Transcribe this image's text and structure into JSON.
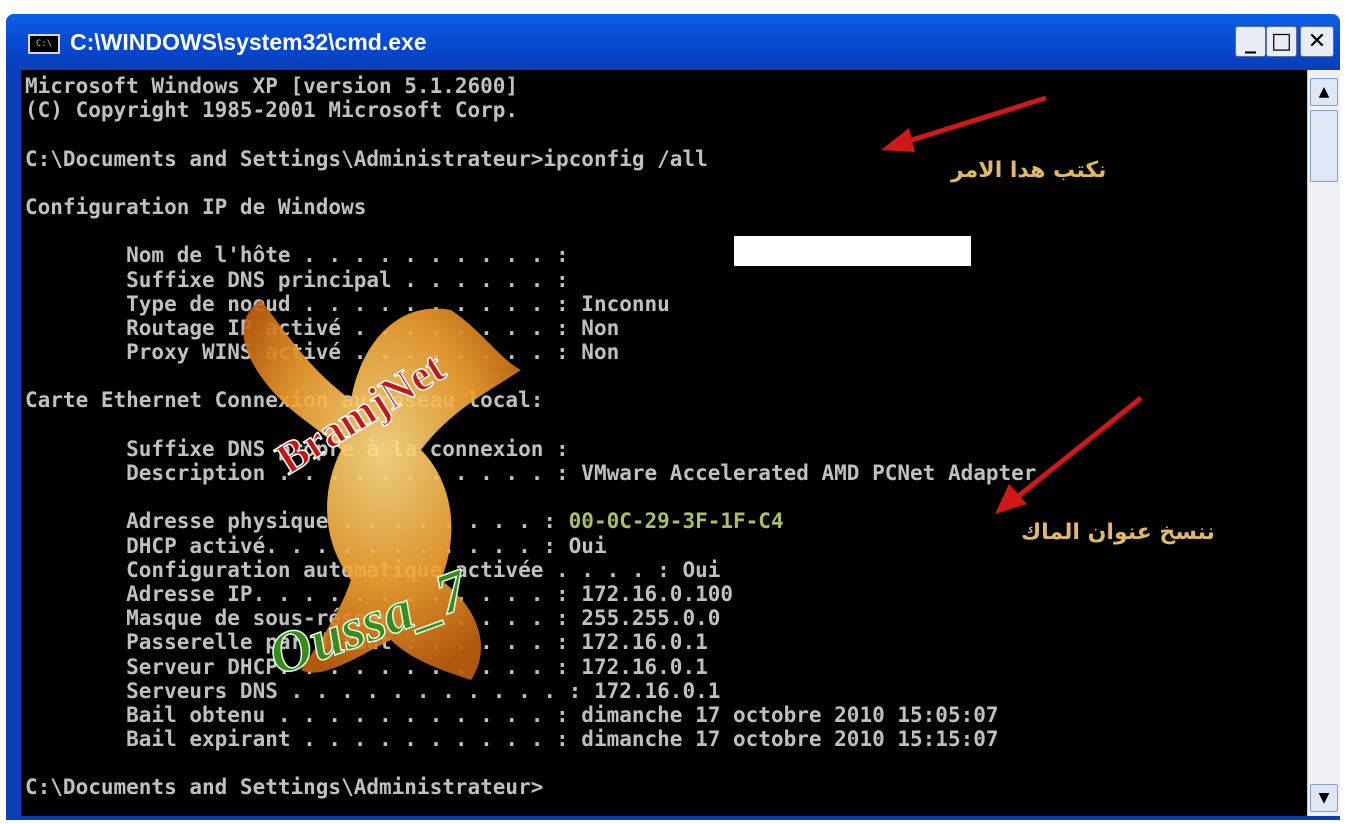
{
  "window": {
    "title": "C:\\WINDOWS\\system32\\cmd.exe",
    "system_icon_label": "C:\\",
    "minimize_label": "_",
    "maximize_label": "□",
    "close_label": "✕"
  },
  "console": {
    "lines": [
      "Microsoft Windows XP [version 5.1.2600]",
      "(C) Copyright 1985-2001 Microsoft Corp.",
      "",
      "C:\\Documents and Settings\\Administrateur>ipconfig /all",
      "",
      "Configuration IP de Windows",
      "",
      "        Nom de l'hôte . . . . . . . . . . :",
      "        Suffixe DNS principal . . . . . . :",
      "        Type de noeud . . . . . . . . . . : Inconnu",
      "        Routage IP activé . . . . . . . . : Non",
      "        Proxy WINS activé . . . . . . . . : Non",
      "",
      "Carte Ethernet Connexion au réseau local:",
      "",
      "        Suffixe DNS propre à la connexion :",
      "        Description . . . . . . . . . . . : VMware Accelerated AMD PCNet Adapter",
      "",
      "        Adresse physique . . . . . . . . :",
      "        DHCP activé. . . . . . . . . . . : Oui",
      "        Configuration automatique activée . . . . : Oui",
      "        Adresse IP. . . . . . . . . . . . : 172.16.0.100",
      "        Masque de sous-réseau . . . . . . : 255.255.0.0",
      "        Passerelle par défaut . . . . . . : 172.16.0.1",
      "        Serveur DHCP. . . . . . . . . . . : 172.16.0.1",
      "        Serveurs DNS . . . . . . . . . . . : 172.16.0.1",
      "        Bail obtenu . . . . . . . . . . . : dimanche 17 octobre 2010 15:05:07",
      "        Bail expirant . . . . . . . . . . : dimanche 17 octobre 2010 15:15:07",
      "",
      "C:\\Documents and Settings\\Administrateur>"
    ],
    "mac_address": "00-0C-29-3F-1F-C4",
    "text_color": "#c0c0c0",
    "highlight_color": "#a8c060",
    "background": "#000000"
  },
  "annotations": {
    "command_note": "نكتب هدا الامر",
    "mac_note": "ننسخ عنوان الماك",
    "arrow_color": "#d01818",
    "note_color": "#e0b868"
  },
  "watermark": {
    "top_text": "BramjNet",
    "bottom_text": "Oussa_7",
    "bird_color": "#f0a030"
  },
  "scrollbar": {
    "up_label": "▲",
    "down_label": "▼"
  }
}
